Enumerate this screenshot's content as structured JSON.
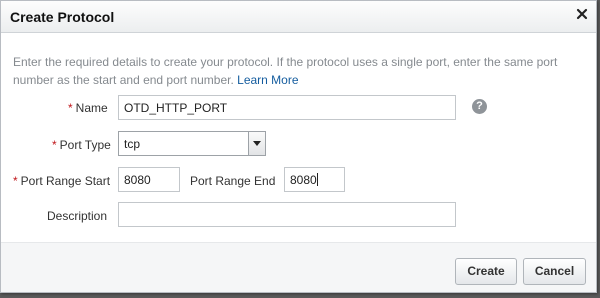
{
  "dialog": {
    "title": "Create Protocol",
    "instructions": "Enter the required details to create your protocol. If the protocol uses a single port, enter the same port number as the start and end port number.",
    "learn_more": "Learn More",
    "required_marker": "*"
  },
  "form": {
    "name_label": "Name",
    "name_value": "OTD_HTTP_PORT",
    "port_type_label": "Port Type",
    "port_type_value": "tcp",
    "port_range_start_label": "Port Range Start",
    "port_range_start_value": "8080",
    "port_range_end_label": "Port Range End",
    "port_range_end_value": "8080",
    "description_label": "Description",
    "description_value": "",
    "help_glyph": "?"
  },
  "footer": {
    "create_label": "Create",
    "cancel_label": "Cancel"
  },
  "colors": {
    "required": "#c0161b",
    "link": "#145c9e",
    "instructions_text": "#858a8f"
  },
  "icons": {
    "close": "close-icon",
    "help": "help-icon",
    "dropdown": "chevron-down-icon"
  }
}
